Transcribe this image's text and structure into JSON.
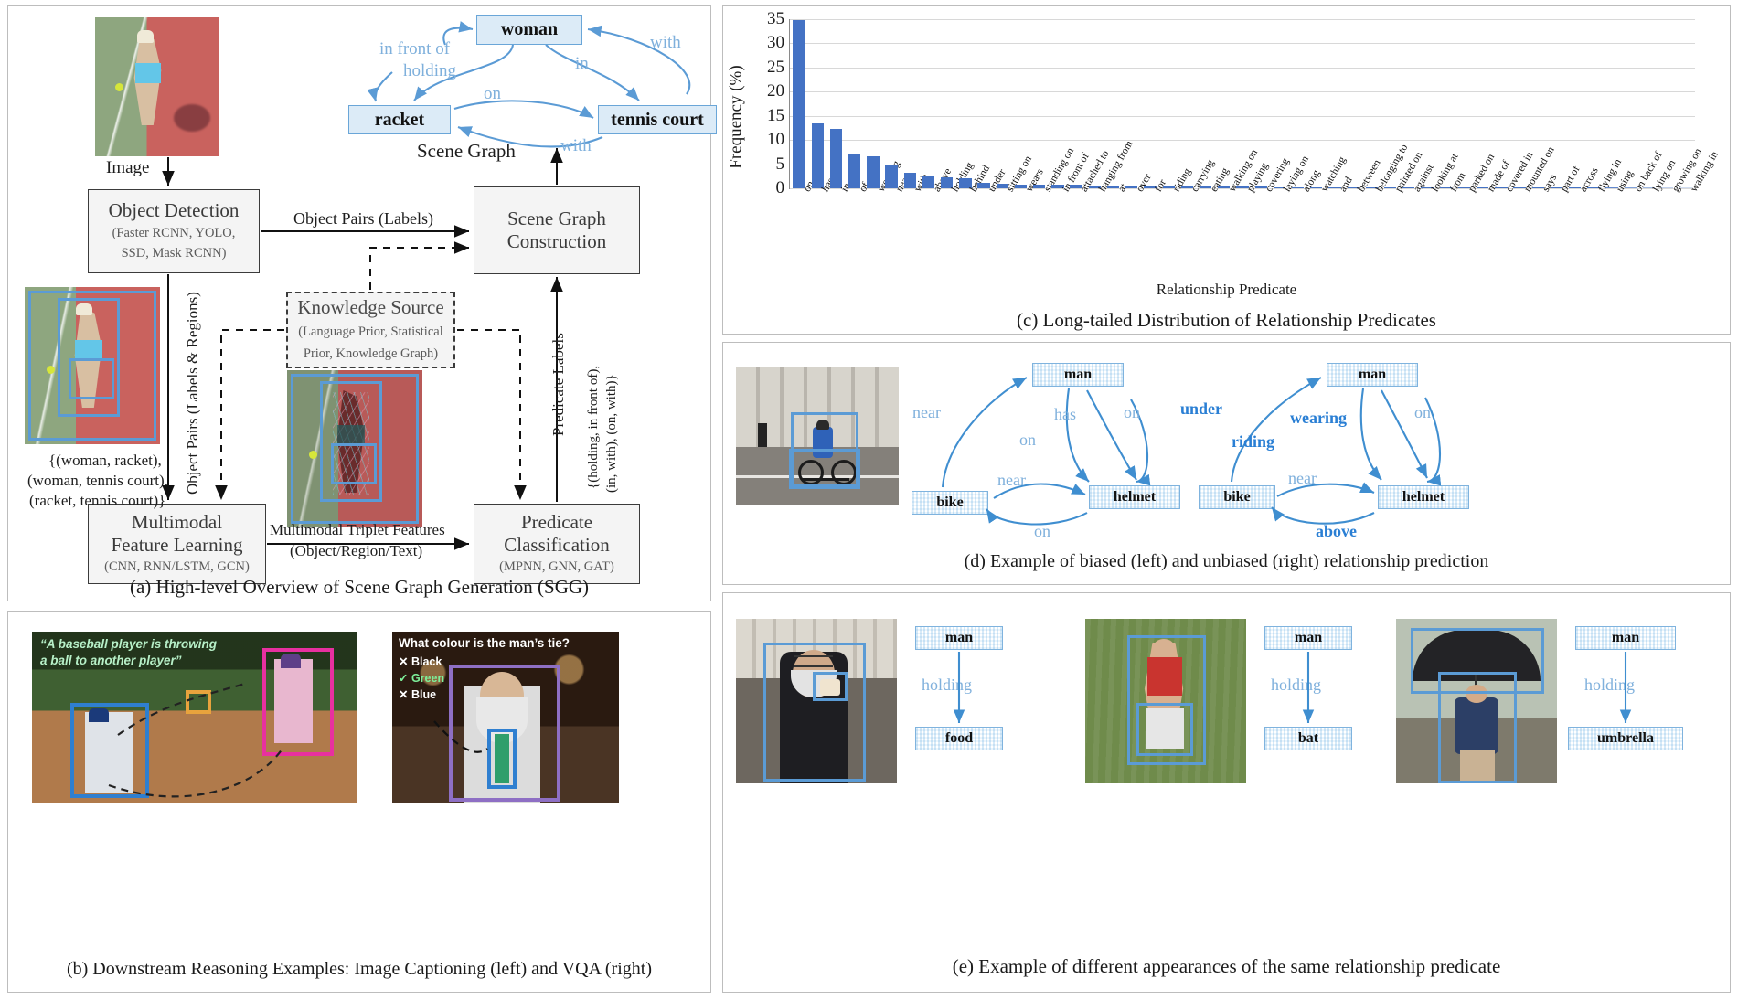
{
  "figure": {
    "panels": {
      "a": {
        "caption": "(a) High-level Overview of Scene Graph Generation (SGG)"
      },
      "b": {
        "caption": "(b) Downstream Reasoning Examples:  Image Captioning (left) and  VQA (right)"
      },
      "c": {
        "caption": "(c) Long-tailed Distribution of Relationship Predicates"
      },
      "d": {
        "caption": "(d) Example of biased (left) and unbiased (right) relationship prediction"
      },
      "e": {
        "caption": "(e) Example of different appearances of the same relationship predicate"
      }
    }
  },
  "panel_a": {
    "scene_graph": {
      "title": "Scene Graph",
      "nodes": [
        {
          "id": "woman",
          "label": "woman"
        },
        {
          "id": "racket",
          "label": "racket"
        },
        {
          "id": "tennis_court",
          "label": "tennis court"
        }
      ],
      "edges": [
        {
          "from": "woman",
          "to": "racket",
          "label": "holding"
        },
        {
          "from": "racket",
          "to": "woman",
          "label": "in front of"
        },
        {
          "from": "woman",
          "to": "tennis_court",
          "label": "in"
        },
        {
          "from": "tennis_court",
          "to": "woman",
          "label": "with"
        },
        {
          "from": "racket",
          "to": "tennis_court",
          "label": "on"
        },
        {
          "from": "tennis_court",
          "to": "racket",
          "label": "with"
        }
      ]
    },
    "boxes": {
      "object_detection": {
        "title": "Object Detection",
        "sub1": "(Faster RCNN, YOLO,",
        "sub2": "SSD, Mask RCNN)"
      },
      "knowledge_source": {
        "title": "Knowledge Source",
        "sub1": "(Language Prior, Statistical",
        "sub2": "Prior, Knowledge Graph)"
      },
      "scene_graph_construction": {
        "line1": "Scene Graph",
        "line2": "Construction"
      },
      "multimodal_feature_learning": {
        "line1": "Multimodal",
        "line2": "Feature Learning",
        "sub": "(CNN, RNN/LSTM, GCN)"
      },
      "predicate_classification": {
        "line1": "Predicate",
        "line2": "Classification",
        "sub": "(MPNN, GNN, GAT)"
      }
    },
    "edge_labels": {
      "image": "Image",
      "object_pairs_labels": "Object Pairs (Labels)",
      "object_pairs_labels_regions": "Object Pairs (Labels & Regions)",
      "multimodal_triplet_1": "Multimodal Triplet Features",
      "multimodal_triplet_2": "(Object/Region/Text)",
      "predicate_labels": "Predicate Labels",
      "predicate_set_1": "{(holding, in front of),",
      "predicate_set_2": "(in, with), (on, with)}"
    },
    "object_pairs_text": [
      "{(woman, racket),",
      "(woman, tennis court),",
      "(racket, tennis court)}"
    ]
  },
  "panel_b": {
    "caption_example": {
      "text_line1": "“A baseball player is throwing",
      "text_line2": "a ball to another player”"
    },
    "vqa_example": {
      "question": "What colour is the man’s tie?",
      "options": [
        {
          "mark": "✕",
          "label": "Black",
          "correct": false
        },
        {
          "mark": "✓",
          "label": "Green",
          "correct": true
        },
        {
          "mark": "✕",
          "label": "Blue",
          "correct": false
        }
      ]
    }
  },
  "panel_d": {
    "biased_graph": {
      "nodes": [
        {
          "id": "man",
          "label": "man"
        },
        {
          "id": "bike",
          "label": "bike"
        },
        {
          "id": "helmet",
          "label": "helmet"
        }
      ],
      "edges": [
        {
          "label": "near"
        },
        {
          "label": "on"
        },
        {
          "label": "has"
        },
        {
          "label": "on"
        },
        {
          "label": "near"
        },
        {
          "label": "on"
        }
      ]
    },
    "unbiased_graph": {
      "nodes": [
        {
          "id": "man",
          "label": "man"
        },
        {
          "id": "bike",
          "label": "bike"
        },
        {
          "id": "helmet",
          "label": "helmet"
        }
      ],
      "edges": [
        {
          "label": "under"
        },
        {
          "label": "riding"
        },
        {
          "label": "wearing"
        },
        {
          "label": "on"
        },
        {
          "label": "near"
        },
        {
          "label": "above"
        }
      ]
    }
  },
  "panel_e": {
    "examples": [
      {
        "subject": "man",
        "predicate": "holding",
        "object": "food"
      },
      {
        "subject": "man",
        "predicate": "holding",
        "object": "bat"
      },
      {
        "subject": "man",
        "predicate": "holding",
        "object": "umbrella"
      }
    ]
  },
  "chart_data": {
    "type": "bar",
    "title": "",
    "xlabel": "Relationship Predicate",
    "ylabel": "Frequency (%)",
    "ylim": [
      0,
      35
    ],
    "yticks": [
      0,
      5,
      10,
      15,
      20,
      25,
      30,
      35
    ],
    "grid": true,
    "legend": "none",
    "bar_color": "#4472c4",
    "categories": [
      "on",
      "has",
      "in",
      "of",
      "wearing",
      "near",
      "with",
      "above",
      "holding",
      "behind",
      "under",
      "sitting on",
      "wears",
      "standing on",
      "in front of",
      "attached to",
      "hanging from",
      "at",
      "over",
      "for",
      "riding",
      "carrying",
      "eating",
      "walking on",
      "playing",
      "covering",
      "laying on",
      "along",
      "watching",
      "and",
      "between",
      "belonging to",
      "painted on",
      "against",
      "looking at",
      "from",
      "parked on",
      "made of",
      "covered in",
      "mounted on",
      "says",
      "part of",
      "across",
      "flying in",
      "using",
      "on back of",
      "lying on",
      "growing on",
      "walking in"
    ],
    "values": [
      34.9,
      13.5,
      12.3,
      7.1,
      6.6,
      4.7,
      3.2,
      2.4,
      2.2,
      2.1,
      1.1,
      0.95,
      0.85,
      0.8,
      0.75,
      0.7,
      0.6,
      0.55,
      0.5,
      0.45,
      0.42,
      0.4,
      0.38,
      0.35,
      0.32,
      0.3,
      0.28,
      0.26,
      0.24,
      0.22,
      0.2,
      0.18,
      0.17,
      0.16,
      0.15,
      0.14,
      0.13,
      0.12,
      0.11,
      0.1,
      0.09,
      0.08,
      0.07,
      0.06,
      0.05,
      0.04,
      0.03,
      0.02,
      0.015
    ]
  }
}
